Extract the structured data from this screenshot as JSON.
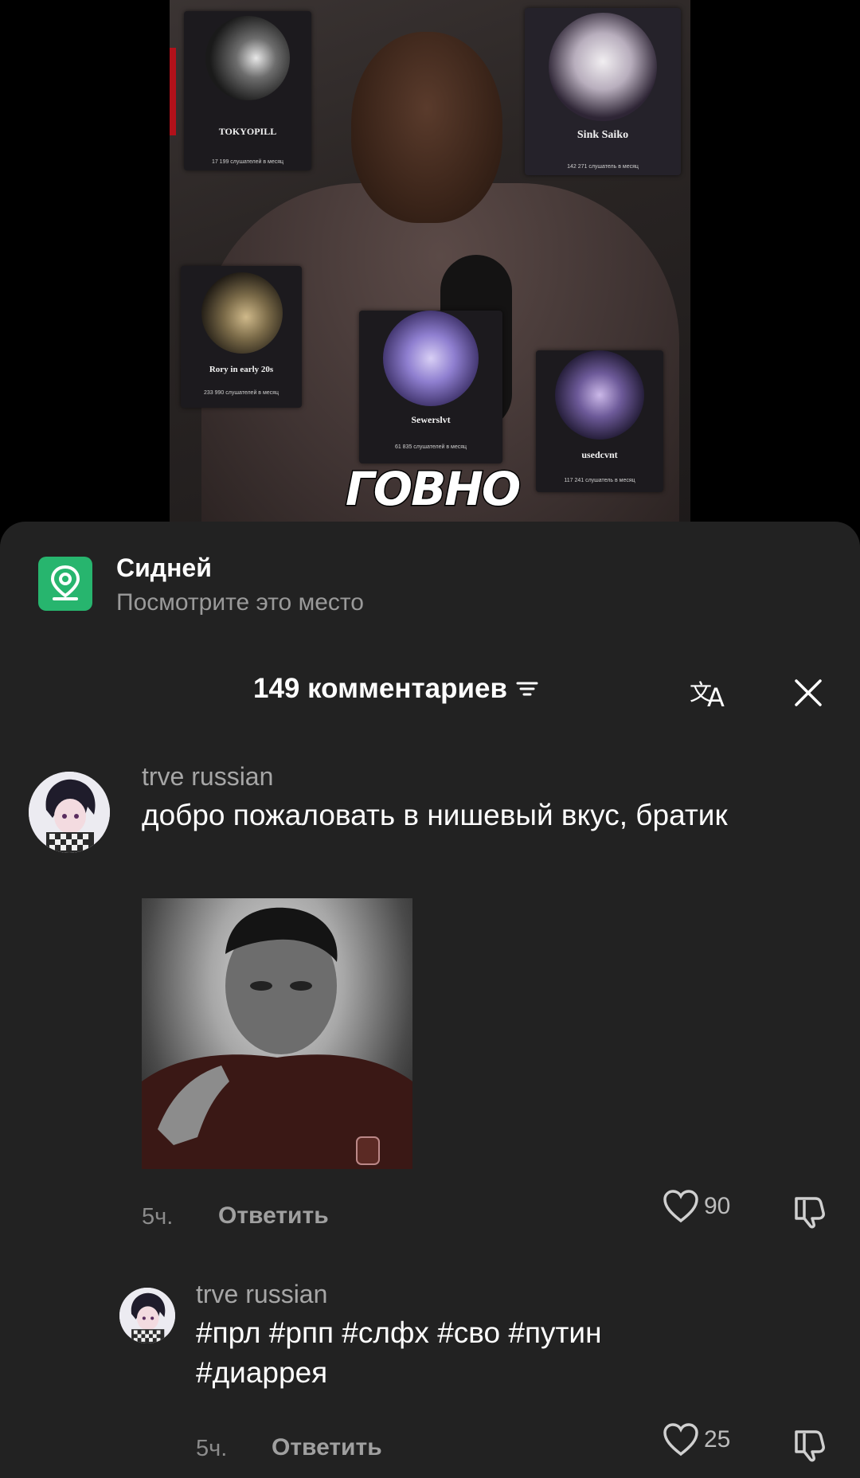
{
  "video": {
    "cards": [
      {
        "artist": "TOKYOPILL",
        "listeners": "17 199 слушателей в месяц"
      },
      {
        "artist": "Sink Saiko",
        "listeners": "142 271 слушатель в месяц"
      },
      {
        "artist": "Rory in early 20s",
        "listeners": "233 990 слушателей в месяц"
      },
      {
        "artist": "Sewerslvt",
        "listeners": "61 835 слушателей в месяц"
      },
      {
        "artist": "usedcvnt",
        "listeners": "117 241 слушатель в месяц"
      }
    ],
    "overlay_text": "ГОВНО"
  },
  "location": {
    "title": "Сидней",
    "subtitle": "Посмотрите это место",
    "icon": "location-pin-icon"
  },
  "comments_header": {
    "count_label": "149 комментариев",
    "sort_icon": "sort-icon",
    "translate_icon": "translate-icon",
    "close_icon": "close-icon"
  },
  "comments": [
    {
      "username": "trve russian",
      "text": "добро пожаловать в нишевый вкус, братик",
      "time": "5ч.",
      "reply_label": "Ответить",
      "likes": "90"
    },
    {
      "username": "trve russian",
      "text": "#прл #рпп #слфх #сво #путин #диаррея",
      "time": "5ч.",
      "reply_label": "Ответить",
      "likes": "25"
    }
  ],
  "colors": {
    "sheet_bg": "#222222",
    "location_green": "#27b56e",
    "muted_text": "#9a9a9a"
  }
}
